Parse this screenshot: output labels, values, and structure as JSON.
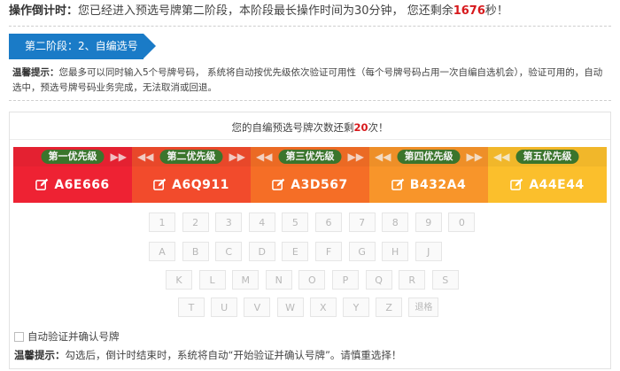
{
  "countdown": {
    "label": "操作倒计时：",
    "text_before": "您已经进入预选号牌第二阶段，本阶段最长操作时间为30分钟， 您还剩余",
    "seconds": "1676",
    "text_after": "秒！"
  },
  "stage": {
    "label": "第二阶段：2、自编选号"
  },
  "tip_top": {
    "label": "温馨提示：",
    "text": "您最多可以同时输入5个号牌号码， 系统将自动按优先级依次验证可用性（每个号牌号码占用一次自编自选机会），验证可用的，自动选中，预选号牌号码业务完成，无法取消或回退。"
  },
  "remaining": {
    "before": "您的自编预选号牌次数还剩",
    "count": "20",
    "after": "次！"
  },
  "slots": [
    {
      "priority": "第一优先级",
      "plate": "A6E666",
      "color": "#ee2233"
    },
    {
      "priority": "第二优先级",
      "plate": "A6Q911",
      "color": "#f24b2c"
    },
    {
      "priority": "第三优先级",
      "plate": "A3D567",
      "color": "#f56e26"
    },
    {
      "priority": "第四优先级",
      "plate": "B432A4",
      "color": "#f8952a"
    },
    {
      "priority": "第五优先级",
      "plate": "A44E44",
      "color": "#fbbf2c"
    }
  ],
  "keyboard": {
    "row1": [
      "1",
      "2",
      "3",
      "4",
      "5",
      "6",
      "7",
      "8",
      "9",
      "0"
    ],
    "row2": [
      "A",
      "B",
      "C",
      "D",
      "E",
      "F",
      "G",
      "H",
      "J"
    ],
    "row3": [
      "K",
      "L",
      "M",
      "N",
      "O",
      "P",
      "Q",
      "R",
      "S"
    ],
    "row4": [
      "T",
      "U",
      "V",
      "W",
      "X",
      "Y",
      "Z"
    ],
    "backspace": "退格"
  },
  "auto_confirm": {
    "label": "自动验证并确认号牌",
    "checked": false
  },
  "tip_bottom": {
    "label": "温馨提示：",
    "text": "勾选后，倒计时结束时，系统将自动“开始验证并确认号牌”。请慎重选择！"
  }
}
